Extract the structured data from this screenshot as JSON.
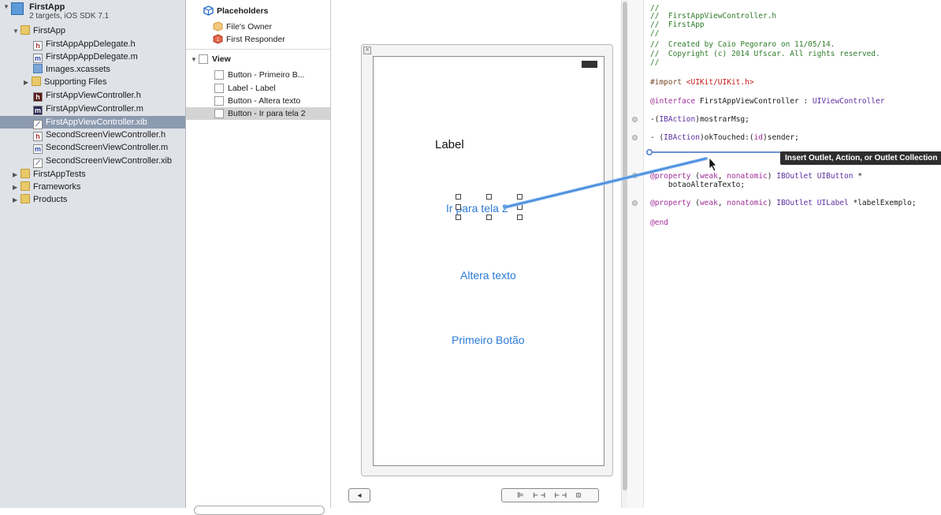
{
  "navigator": {
    "project": {
      "name": "FirstApp",
      "subtitle": "2 targets, iOS SDK 7.1"
    },
    "items": [
      {
        "label": "FirstApp",
        "kind": "folder"
      },
      {
        "label": "FirstAppAppDelegate.h",
        "kind": "h"
      },
      {
        "label": "FirstAppAppDelegate.m",
        "kind": "m"
      },
      {
        "label": "Images.xcassets",
        "kind": "assets"
      },
      {
        "label": "Supporting Files",
        "kind": "folder"
      },
      {
        "label": "FirstAppViewController.h",
        "kind": "h"
      },
      {
        "label": "FirstAppViewController.m",
        "kind": "m"
      },
      {
        "label": "FirstAppViewController.xib",
        "kind": "xib",
        "selected": true
      },
      {
        "label": "SecondScreenViewController.h",
        "kind": "h"
      },
      {
        "label": "SecondScreenViewController.m",
        "kind": "m"
      },
      {
        "label": "SecondScreenViewController.xib",
        "kind": "xib"
      },
      {
        "label": "FirstAppTests",
        "kind": "folder"
      },
      {
        "label": "Frameworks",
        "kind": "folder"
      },
      {
        "label": "Products",
        "kind": "folder"
      }
    ]
  },
  "outline": {
    "placeholders_title": "Placeholders",
    "files_owner": "File's Owner",
    "first_responder": "First Responder",
    "view_title": "View",
    "children": [
      "Button - Primeiro B...",
      "Label - Label",
      "Button - Altera texto",
      "Button - Ir para tela 2"
    ]
  },
  "canvas": {
    "label_text": "Label",
    "button_ir": "Ir para tela 2",
    "button_altera": "Altera texto",
    "button_primeiro": "Primeiro Botão"
  },
  "editor": {
    "lines": {
      "l1": "//",
      "l2": "//  FirstAppViewController.h",
      "l3": "//  FirstApp",
      "l4": "//",
      "l5": "//  Created by Caio Pegoraro on 11/05/14.",
      "l6": "//  Copyright (c) 2014 Ufscar. All rights reserved.",
      "l7": "//"
    },
    "import_kw": "#import ",
    "import_path": "<UIKit/UIKit.h>",
    "interface_kw": "@interface",
    "interface_name": " FirstAppViewController : ",
    "interface_super": "UIViewController",
    "m1_prefix": "-(",
    "m1_type": "IBAction",
    "m1_rest": ")mostrarMsg;",
    "m2_prefix": "- (",
    "m2_type": "IBAction",
    "m2_mid": ")okTouched:(",
    "m2_id": "id",
    "m2_rest": ")sender;",
    "p1_kw": "@property",
    "p1_open": " (",
    "p1_weak": "weak",
    "p1_comma": ", ",
    "p1_nonatomic": "nonatomic",
    "p1_close": ") ",
    "p1_outlet": "IBOutlet",
    "p1_type": " UIButton",
    "p1_star": " *",
    "p1_name": "    botaoAlteraTexto;",
    "p2_kw": "@property",
    "p2_open": " (",
    "p2_weak": "weak",
    "p2_comma": ", ",
    "p2_nonatomic": "nonatomic",
    "p2_close": ") ",
    "p2_outlet": "IBOutlet",
    "p2_type": " UILabel",
    "p2_name": " *labelExemplo;",
    "end_kw": "@end"
  },
  "connection_tooltip": "Insert Outlet, Action, or Outlet Collection",
  "colors": {
    "link_line": "#4a90e2",
    "selection": "#8c9ab0",
    "button_text": "#2a7ad6"
  }
}
